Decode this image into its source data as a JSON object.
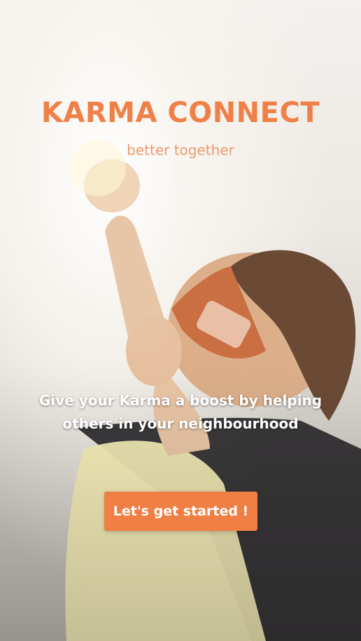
{
  "app": {
    "title": "KARMA CONNECT",
    "tagline": "better together"
  },
  "hero": {
    "image_icon": "hero-child-superhero-photo"
  },
  "message": {
    "line1": "Give your Karma a boost by helping",
    "line2": "others in your neighbourhood"
  },
  "cta": {
    "label": "Let's get started !"
  },
  "colors": {
    "brand_orange": "#ef8047",
    "tagline_orange": "#ed9a6e",
    "button_bg": "#ef7f45",
    "button_text": "#ffffff"
  }
}
